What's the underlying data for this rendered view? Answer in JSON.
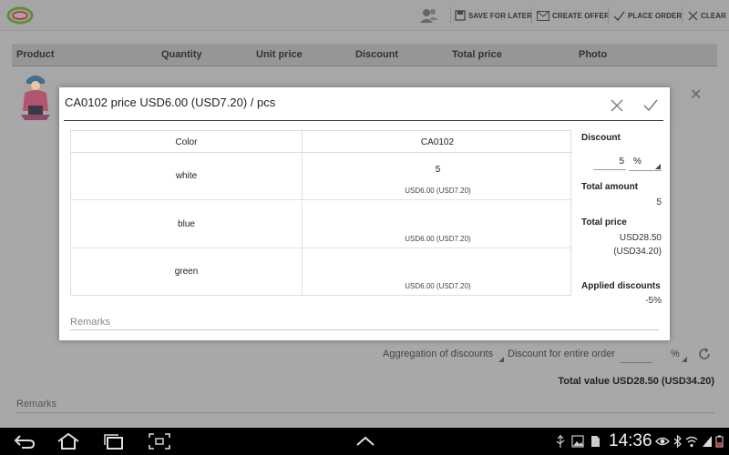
{
  "actionbar": {
    "save_for_later": "SAVE FOR LATER",
    "create_offer": "CREATE OFFER",
    "place_order": "PLACE ORDER",
    "clear": "CLEAR"
  },
  "table": {
    "headers": [
      "Product",
      "Quantity",
      "Unit price",
      "Discount",
      "Total price",
      "Photo"
    ]
  },
  "dialog": {
    "title": "CA0102 price USD6.00 (USD7.20) / pcs",
    "variants": {
      "color_header": "Color",
      "product_header": "CA0102",
      "rows": [
        {
          "color": "white",
          "quantity": "5",
          "unit_price": "USD6.00 (USD7.20)"
        },
        {
          "color": "blue",
          "quantity": "",
          "unit_price": "USD6.00 (USD7.20)"
        },
        {
          "color": "green",
          "quantity": "",
          "unit_price": "USD6.00 (USD7.20)"
        }
      ]
    },
    "side": {
      "discount_label": "Discount",
      "discount_value": "5",
      "discount_unit": "%",
      "total_amount_label": "Total amount",
      "total_amount_value": "5",
      "total_price_label": "Total price",
      "total_price_line1": "USD28.50",
      "total_price_line2": "(USD34.20)",
      "applied_discounts_label": "Applied discounts",
      "applied_discounts_value": "-5%"
    },
    "remarks_placeholder": "Remarks"
  },
  "footer": {
    "aggregation": "Aggregation of discounts",
    "discount_entire_order": "Discount for entire order",
    "discount_unit": "%",
    "total_value": "Total value USD28.50 (USD34.20)",
    "remarks_placeholder": "Remarks"
  },
  "system": {
    "time": "14:36"
  },
  "colors": {
    "dim_background": "#a8a8a8",
    "dialog_background": "#ffffff",
    "system_bar": "#000000"
  }
}
